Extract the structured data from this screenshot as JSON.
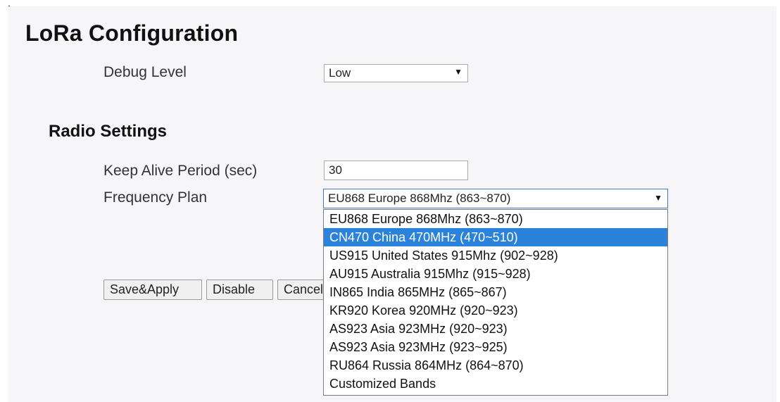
{
  "page": {
    "title": "LoRa Configuration"
  },
  "debug_level": {
    "label": "Debug Level",
    "value": "Low"
  },
  "radio_settings": {
    "title": "Radio Settings",
    "keep_alive": {
      "label": "Keep Alive Period (sec)",
      "value": "30"
    },
    "frequency_plan": {
      "label": "Frequency Plan",
      "value": "EU868 Europe 868Mhz (863~870)",
      "dropdown_open": true,
      "highlighted_index": 1,
      "options": [
        "EU868 Europe 868Mhz (863~870)",
        "CN470 China 470MHz (470~510)",
        "US915 United States 915Mhz (902~928)",
        "AU915 Australia 915Mhz (915~928)",
        "IN865 India 865MHz (865~867)",
        "KR920 Korea 920MHz (920~923)",
        "AS923 Asia 923MHz (920~923)",
        "AS923 Asia 923MHz (923~925)",
        "RU864 Russia 864MHz (864~870)",
        "Customized Bands"
      ]
    }
  },
  "buttons": {
    "save_apply": "Save&Apply",
    "disable": "Disable",
    "cancel": "Cancel"
  },
  "icons": {
    "select_arrow": "dropdown-arrow-icon",
    "corner": "dots-icon"
  },
  "colors": {
    "highlight": "#2a82da",
    "background": "#f6f5f8"
  }
}
